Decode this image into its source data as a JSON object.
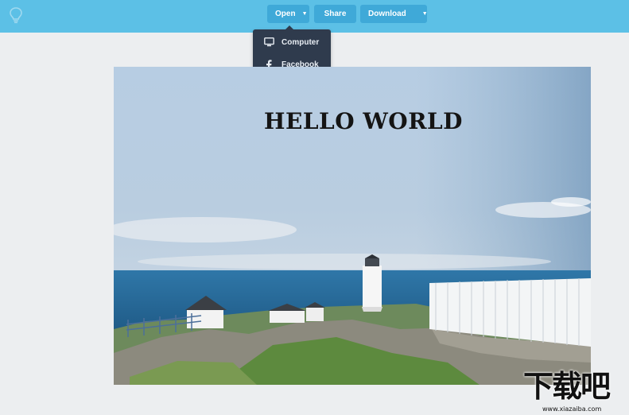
{
  "toolbar": {
    "open_label": "Open",
    "share_label": "Share",
    "download_label": "Download",
    "bulb_icon": "lightbulb-icon",
    "bar_color": "#5cc0e6",
    "button_color": "#3fa9d8"
  },
  "open_menu": {
    "items": [
      {
        "label": "Computer",
        "icon": "monitor-icon"
      },
      {
        "label": "Facebook",
        "icon": "facebook-icon"
      }
    ],
    "background": "#2f3b4d"
  },
  "canvas": {
    "headline": "HELLO WORLD"
  },
  "watermark": {
    "text": "下载吧",
    "url": "www.xiazaiba.com"
  }
}
